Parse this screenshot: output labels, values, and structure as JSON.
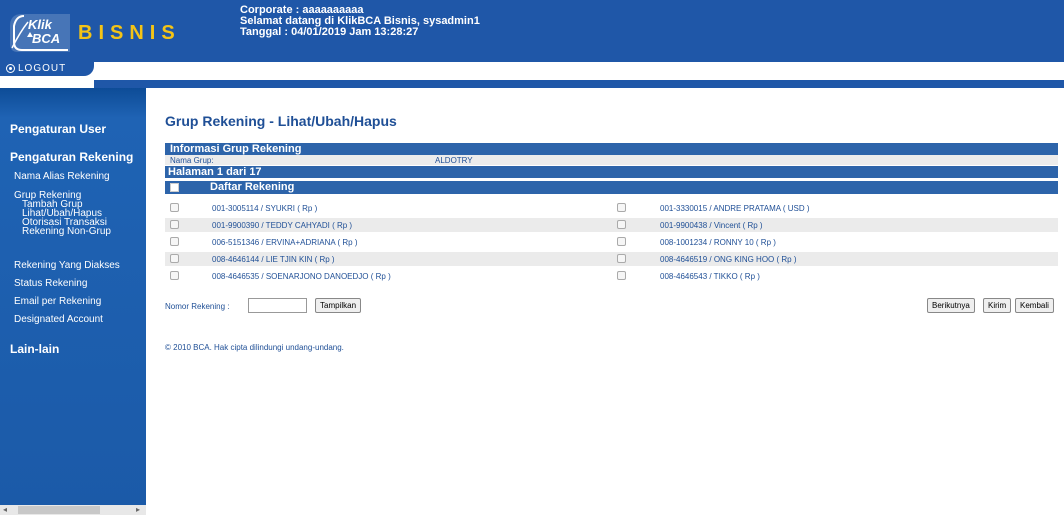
{
  "header": {
    "logo_top": "Klik",
    "logo_bottom": "BCA",
    "brand": "BISNIS",
    "corporate": "Corporate : aaaaaaaaaa",
    "welcome": "Selamat datang di KlikBCA Bisnis, sysadmin1",
    "date": "Tanggal : 04/01/2019 Jam 13:28:27",
    "logout": "LOGOUT",
    "colors": {
      "primary": "#1f57a8",
      "brand": "#f4c416"
    }
  },
  "sidebar": {
    "section_user": "Pengaturan User",
    "section_rekening": "Pengaturan Rekening",
    "nama_alias": "Nama Alias Rekening",
    "grup_rekening": "Grup Rekening",
    "grup_sub": [
      "Tambah Grup",
      "Lihat/Ubah/Hapus",
      "Otorisasi Transaksi",
      "Rekening Non-Grup"
    ],
    "rekening_diakses": "Rekening Yang Diakses",
    "status_rekening": "Status Rekening",
    "email_rekening": "Email per Rekening",
    "designated": "Designated Account",
    "section_lain": "Lain-lain"
  },
  "main": {
    "title": "Grup Rekening - Lihat/Ubah/Hapus",
    "info_header": "Informasi Grup Rekening",
    "nama_grup_label": "Nama Grup:",
    "nama_grup_value": "ALDOTRY",
    "halaman": "Halaman  1  dari  17",
    "daftar_header": "Daftar Rekening",
    "accounts_left": [
      "001-3005114 / SYUKRI ( Rp )",
      "001-9900390 / TEDDY CAHYADI ( Rp )",
      "006-5151346 / ERVINA+ADRIANA ( Rp )",
      "008-4646144 / LIE TJIN KIN ( Rp )",
      "008-4646535 / SOENARJONO DANOEDJO ( Rp )"
    ],
    "accounts_right": [
      "001-3330015 / ANDRE PRATAMA ( USD )",
      "001-9900438 / Vincent ( Rp )",
      "008-1001234 / RONNY 10 ( Rp )",
      "008-4646519 / ONG KING HOO ( Rp )",
      "008-4646543 / TIKKO ( Rp )"
    ],
    "search_label": "Nomor Rekening  :",
    "search_value": "",
    "btn_tampilkan": "Tampilkan",
    "btn_berikutnya": "Berikutnya",
    "btn_kirim": "Kirim",
    "btn_kembali": "Kembali",
    "copyright": "© 2010 BCA. Hak cipta dilindungi undang-undang."
  }
}
